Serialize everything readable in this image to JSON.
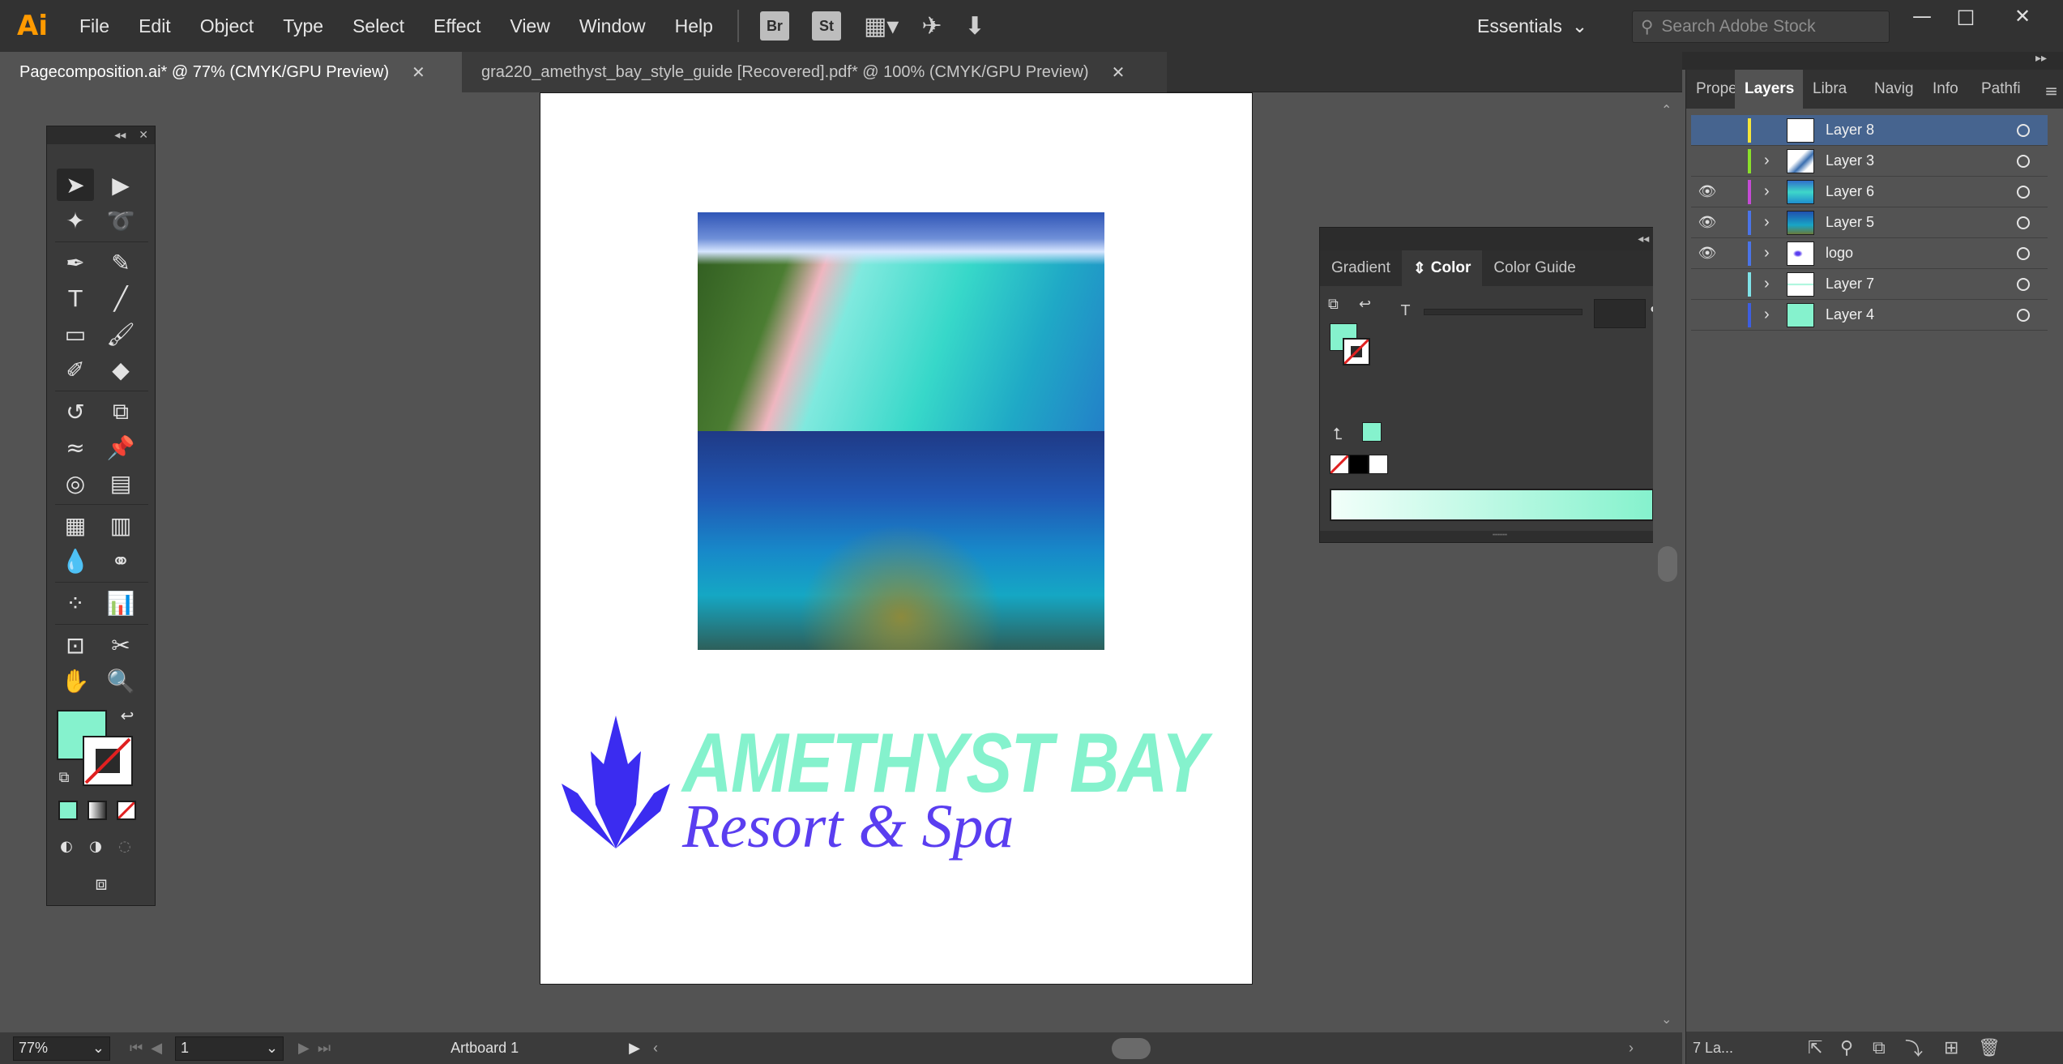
{
  "app": {
    "logo_text": "Ai",
    "menu": [
      "File",
      "Edit",
      "Object",
      "Type",
      "Select",
      "Effect",
      "View",
      "Window",
      "Help"
    ],
    "toolbar": {
      "bridge": "Br",
      "stock": "St"
    },
    "workspace": "Essentials",
    "search_placeholder": "Search Adobe Stock"
  },
  "tabs": [
    {
      "label": "Pagecomposition.ai* @ 77% (CMYK/GPU Preview)",
      "active": true
    },
    {
      "label": "gra220_amethyst_bay_style_guide [Recovered].pdf* @ 100% (CMYK/GPU Preview)",
      "active": false
    }
  ],
  "artboard": {
    "logo_title": "AMETHYST BAY",
    "logo_subtitle": "Resort & Spa",
    "colors": {
      "title": "#85f2cd",
      "subtitle": "#5a3ef0",
      "leaf": "#3b2cf0"
    }
  },
  "color_panel": {
    "tabs": [
      "Gradient",
      "Color",
      "Color Guide"
    ],
    "active_tab": "Color",
    "tint_label": "T",
    "tint_unit": "%",
    "fill_color": "#85f2cd"
  },
  "dock_tabs": [
    "Prope",
    "Layers",
    "Libra",
    "Navig",
    "Info",
    "Pathfi"
  ],
  "layers": [
    {
      "name": "Layer 8",
      "color": "#f5e53a",
      "visible": false,
      "selected": true,
      "expandable": false
    },
    {
      "name": "Layer 3",
      "color": "#8ae02a",
      "visible": false,
      "selected": false,
      "expandable": true
    },
    {
      "name": "Layer 6",
      "color": "#c64ad6",
      "visible": true,
      "selected": false,
      "expandable": true
    },
    {
      "name": "Layer 5",
      "color": "#4a74e8",
      "visible": true,
      "selected": false,
      "expandable": true
    },
    {
      "name": "logo",
      "color": "#4a74e8",
      "visible": true,
      "selected": false,
      "expandable": true
    },
    {
      "name": "Layer 7",
      "color": "#7fe3e8",
      "visible": false,
      "selected": false,
      "expandable": true
    },
    {
      "name": "Layer 4",
      "color": "#3d5ee0",
      "visible": false,
      "selected": false,
      "expandable": true
    }
  ],
  "layers_footer": "7 La...",
  "status": {
    "zoom": "77%",
    "artboard_number": "1",
    "artboard_name": "Artboard 1"
  }
}
